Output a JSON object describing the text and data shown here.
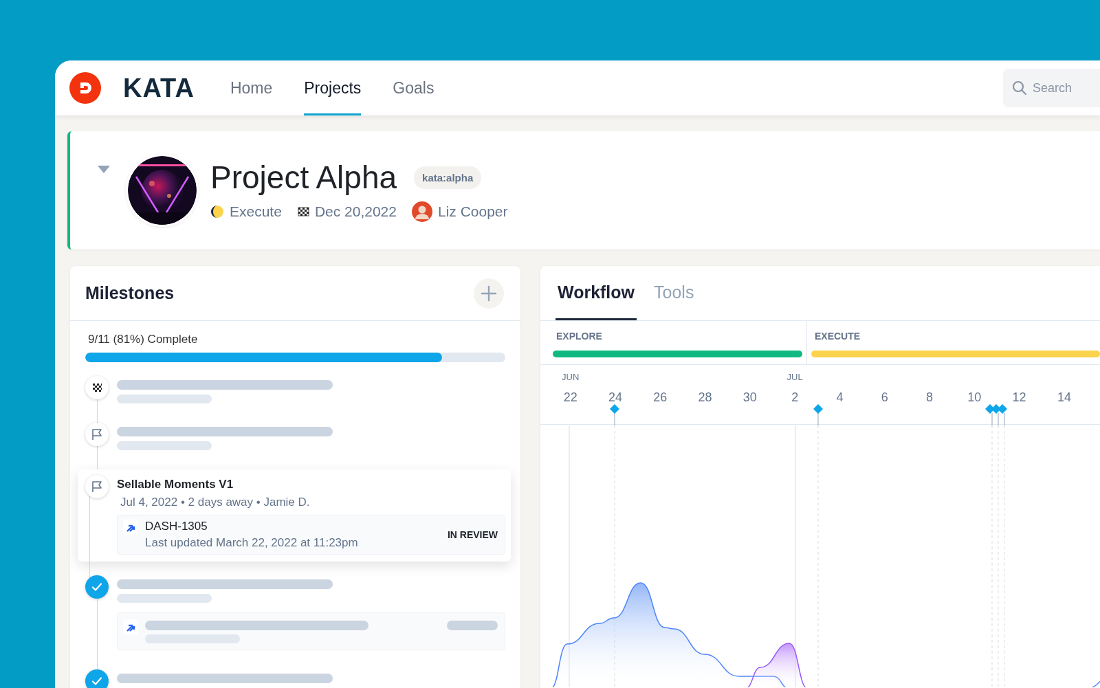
{
  "nav": {
    "brand": "KATA",
    "items": [
      {
        "label": "Home",
        "selected": false
      },
      {
        "label": "Projects",
        "selected": true
      },
      {
        "label": "Goals",
        "selected": false
      }
    ],
    "search": {
      "placeholder": "Search"
    }
  },
  "project": {
    "expanded": true,
    "title": "Project Alpha",
    "tag": "kata:alpha",
    "phase": "Execute",
    "due": "Dec 20,2022",
    "owner": "Liz Cooper"
  },
  "milestones": {
    "title": "Milestones",
    "progress_label": "9/11 (81%) Complete",
    "level": 0.85,
    "items": [
      {
        "kind": "finish",
        "selected": false
      },
      {
        "kind": "flag",
        "selected": false
      },
      {
        "kind": "flag",
        "selected": true,
        "title": "Sellable Moments V1",
        "meta": "Jul 4, 2022 • 2 days away • Jamie D.",
        "issue": {
          "loading": false,
          "key": "DASH-1305",
          "updated": "Last updated March 22, 2022 at 11:23pm",
          "status": "IN REVIEW"
        }
      },
      {
        "kind": "done",
        "selected": false,
        "issue": {
          "loading": true
        }
      },
      {
        "kind": "done",
        "selected": false
      }
    ]
  },
  "workflow": {
    "tabs": [
      {
        "label": "Workflow",
        "selected": true
      },
      {
        "label": "Tools",
        "selected": false
      }
    ],
    "phases": [
      {
        "label": "EXPLORE",
        "color": "#10b981"
      },
      {
        "label": "EXECUTE",
        "color": "#fcd34d"
      }
    ],
    "dates": [
      {
        "month": "JUN",
        "day": "22"
      },
      {
        "day": "24"
      },
      {
        "day": "26"
      },
      {
        "day": "28"
      },
      {
        "day": "30"
      },
      {
        "month": "JUL",
        "day": "2"
      },
      {
        "day": "4"
      },
      {
        "day": "6"
      },
      {
        "day": "8"
      },
      {
        "day": "10"
      },
      {
        "day": "12"
      },
      {
        "day": "14"
      }
    ]
  }
}
